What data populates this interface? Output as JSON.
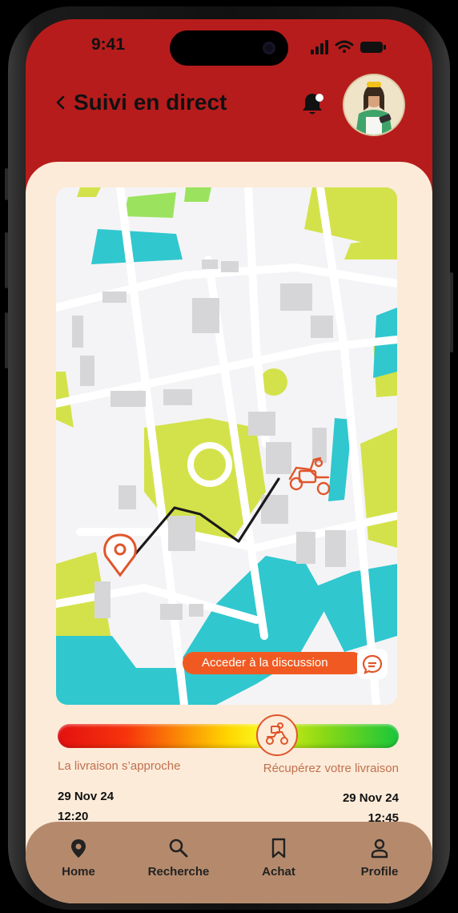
{
  "status": {
    "time": "9:41"
  },
  "header": {
    "title": "Suivi en direct"
  },
  "map": {
    "chat_label": "Acceder à la discussion"
  },
  "progress": {
    "level": 0.64,
    "left_label": "La livraison s’approche",
    "right_label": "Récupérez votre livraison",
    "start_date": "29 Nov 24",
    "start_time": "12:20",
    "end_date": "29 Nov 24",
    "end_time": "12:45"
  },
  "nav": {
    "items": [
      {
        "label": "Home",
        "icon": "location-pin-icon"
      },
      {
        "label": "Recherche",
        "icon": "search-icon"
      },
      {
        "label": "Achat",
        "icon": "bookmark-icon"
      },
      {
        "label": "Profile",
        "icon": "person-icon"
      }
    ]
  },
  "colors": {
    "brand": "#b71c1c",
    "accent": "#f05a22",
    "card": "#fcebd9",
    "nav": "#b58a6c"
  }
}
